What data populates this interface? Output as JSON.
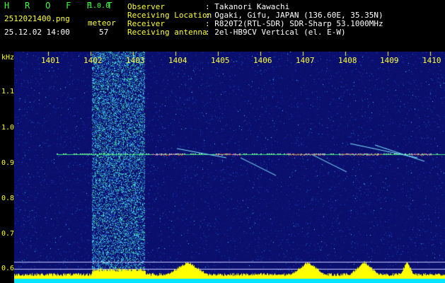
{
  "header": {
    "app_title": "H R O F F T",
    "version": "1.0.0",
    "filename": "2512021400.png",
    "datetime": "25.12.02 14:00",
    "meteor_label": "meteor",
    "meteor_count": "57",
    "info": [
      {
        "label": "Observer",
        "value": ": Takanori Kawachi"
      },
      {
        "label": "Receiving Location",
        "value": ": Ogaki, Gifu, JAPAN (136.60E, 35.35N)"
      },
      {
        "label": "Receiver",
        "value": ": R820T2(RTL-SDR) SDR-Sharp 53.1000MHz"
      },
      {
        "label": "Receiving antenna",
        "value": ": 2el-HB9CV Vertical (el. E-W)"
      }
    ]
  },
  "axes": {
    "y_unit": "kHz",
    "y_ticks": [
      "1.1",
      "1.0",
      "0.9",
      "0.8",
      "0.7",
      "0.6"
    ],
    "x_ticks": [
      "1401",
      "1402",
      "1403",
      "1404",
      "1405",
      "1406",
      "1407",
      "1408",
      "1409",
      "1410"
    ]
  },
  "colors": {
    "background": "#000000",
    "label": "#ffff33",
    "text": "#ffffff",
    "spectrogram_base": "#0a0f6e",
    "signal": "#ff3030",
    "level_bar": "#ffff00",
    "baseline": "#00e5ff"
  }
}
